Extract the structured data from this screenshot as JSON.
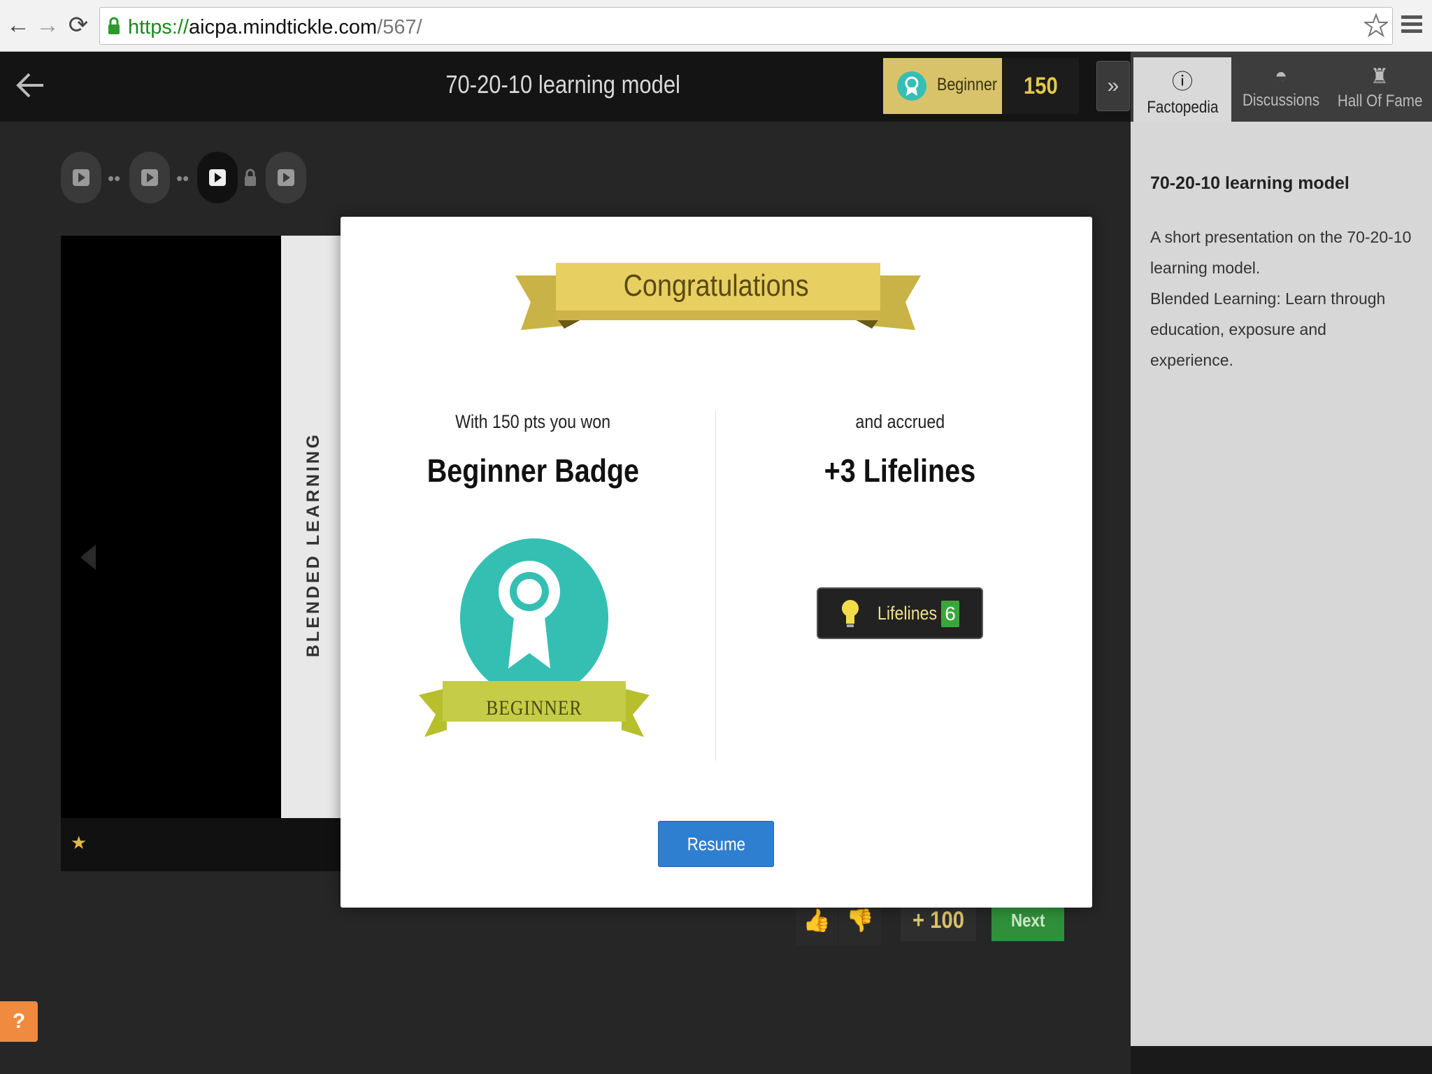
{
  "browser": {
    "url_scheme": "https://",
    "url_domain": "aicpa.mindtickle.com",
    "url_path": "/567/"
  },
  "header": {
    "title": "70-20-10 learning model",
    "level_label": "Beginner",
    "points": "150",
    "collapse_icon": "»"
  },
  "tabs": [
    {
      "label": "Factopedia",
      "icon": "info-icon"
    },
    {
      "label": "Discussions",
      "icon": "helmet-icon"
    },
    {
      "label": "Hall Of Fame",
      "icon": "trophy-icon"
    }
  ],
  "factopedia": {
    "title": "70-20-10 learning model",
    "text1": "A short presentation on the 70-20-10 learning model.",
    "text2": "Blended Learning: Learn through education, exposure and experience."
  },
  "slide": {
    "vertical_text": "BLENDED LEARNING"
  },
  "bottom": {
    "plus_points": "+ 100",
    "next_label": "Next"
  },
  "modal": {
    "banner_text": "Congratulations",
    "left_sub": "With 150 pts you won",
    "left_title": "Beginner Badge",
    "badge_ribbon": "BEGINNER",
    "right_sub": "and accrued",
    "right_title": "+3 Lifelines",
    "lifelines_label": "Lifelines",
    "lifelines_count": "6",
    "resume_label": "Resume"
  },
  "colors": {
    "accent_gold": "#d9c36a",
    "badge_teal": "#35bfb3",
    "ribbon_green": "#c2c84a",
    "resume_blue": "#2e7fd0",
    "next_green": "#2f8f3a"
  }
}
